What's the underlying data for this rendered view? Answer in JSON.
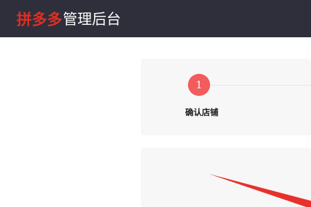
{
  "header": {
    "brand": "拼多多",
    "title": "管理后台"
  },
  "steps": [
    {
      "number": "1",
      "label": "确认店铺"
    }
  ],
  "colors": {
    "header_bg": "#2e2f3b",
    "brand_red": "#e02e24",
    "step_active": "#f25c5c",
    "annotation_arrow": "#e8312a"
  }
}
